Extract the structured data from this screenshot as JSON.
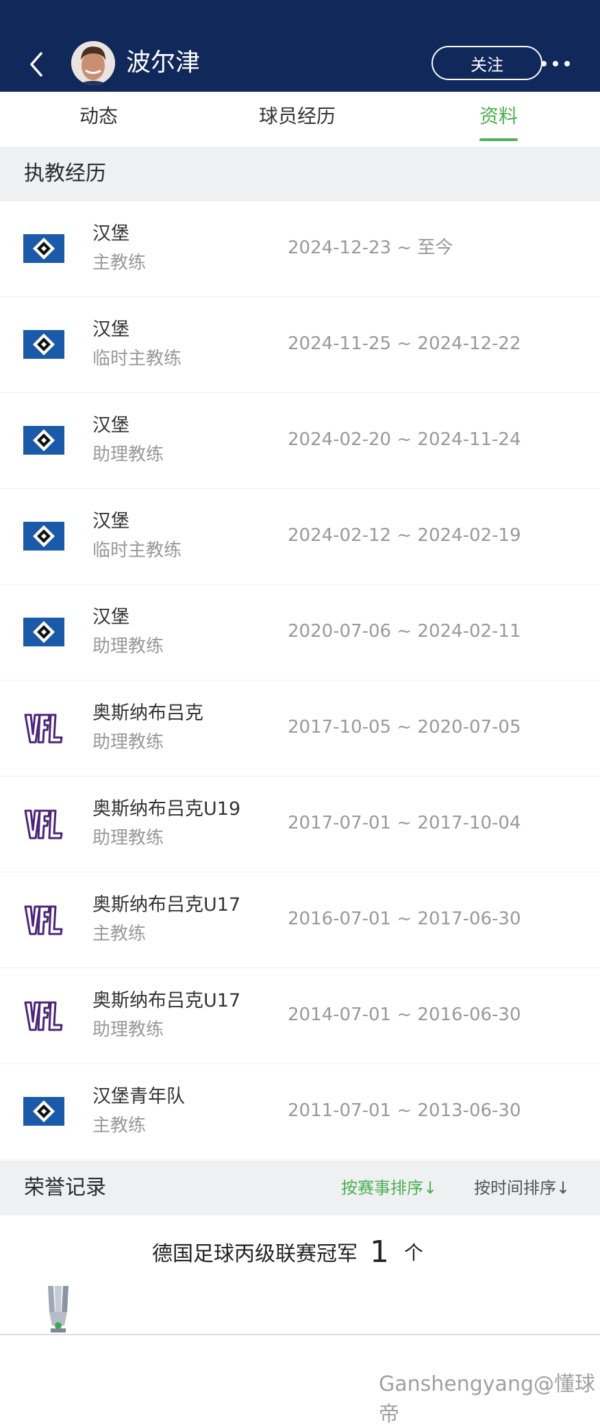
{
  "header": {
    "player_name": "波尔津",
    "follow_label": "关注",
    "background_color": "#10295a"
  },
  "tabs": [
    {
      "label": "动态",
      "active": false
    },
    {
      "label": "球员经历",
      "active": false
    },
    {
      "label": "资料",
      "active": true
    }
  ],
  "accent_color": "#4cb050",
  "coaching": {
    "title": "执教经历",
    "rows": [
      {
        "team": "汉堡",
        "role": "主教练",
        "period": "2024-12-23 ~ 至今",
        "logo": "hsv-diamond-icon"
      },
      {
        "team": "汉堡",
        "role": "临时主教练",
        "period": "2024-11-25 ~ 2024-12-22",
        "logo": "hsv-diamond-icon"
      },
      {
        "team": "汉堡",
        "role": "助理教练",
        "period": "2024-02-20 ~ 2024-11-24",
        "logo": "hsv-diamond-icon"
      },
      {
        "team": "汉堡",
        "role": "临时主教练",
        "period": "2024-02-12 ~ 2024-02-19",
        "logo": "hsv-diamond-icon"
      },
      {
        "team": "汉堡",
        "role": "助理教练",
        "period": "2020-07-06 ~ 2024-02-11",
        "logo": "hsv-diamond-icon"
      },
      {
        "team": "奥斯纳布吕克",
        "role": "助理教练",
        "period": "2017-10-05 ~ 2020-07-05",
        "logo": "vfl-icon"
      },
      {
        "team": "奥斯纳布吕克U19",
        "role": "助理教练",
        "period": "2017-07-01 ~ 2017-10-04",
        "logo": "vfl-icon"
      },
      {
        "team": "奥斯纳布吕克U17",
        "role": "主教练",
        "period": "2016-07-01 ~ 2017-06-30",
        "logo": "vfl-icon"
      },
      {
        "team": "奥斯纳布吕克U17",
        "role": "助理教练",
        "period": "2014-07-01 ~ 2016-06-30",
        "logo": "vfl-icon"
      },
      {
        "team": "汉堡青年队",
        "role": "主教练",
        "period": "2011-07-01 ~ 2013-06-30",
        "logo": "hsv-diamond-icon"
      }
    ]
  },
  "honors": {
    "title": "荣誉记录",
    "sort_by_event": "按赛事排序↓",
    "sort_by_time": "按时间排序↓",
    "items": [
      {
        "name": "德国足球丙级联赛冠军",
        "count": "1",
        "unit": "个"
      }
    ]
  },
  "watermark": "Ganshengyang@懂球帝"
}
